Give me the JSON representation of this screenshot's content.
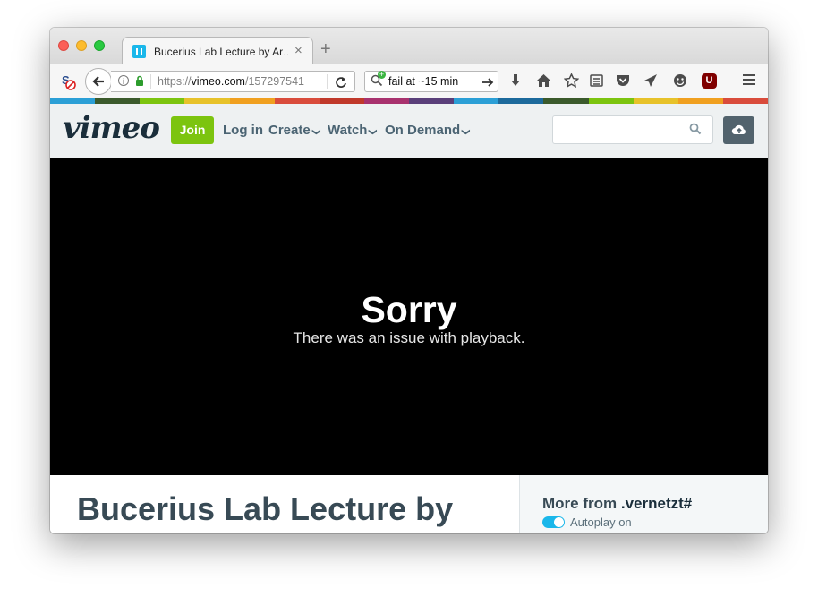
{
  "browser": {
    "tab": {
      "title": "Bucerius Lab Lecture by Ar…",
      "close": "×"
    },
    "new_tab": "+",
    "url": {
      "scheme": "https://",
      "host": "vimeo.com",
      "path": "/157297541"
    },
    "search_query": "fail at ~15 min",
    "extension_ublock": "U"
  },
  "colorbar": [
    "#2b9fd6",
    "#3b5a2c",
    "#7cc40f",
    "#e7c22a",
    "#f0a020",
    "#d94c3c",
    "#c0392b",
    "#a8326e",
    "#5a3f7a",
    "#2b9fd6",
    "#1d6a9c",
    "#3b5a2c",
    "#7cc40f",
    "#e7c22a",
    "#f0a020",
    "#d94c3c"
  ],
  "vimeo": {
    "logo": "vimeo",
    "join": "Join",
    "nav": {
      "login": "Log in",
      "create": "Create",
      "watch": "Watch",
      "on_demand": "On Demand"
    },
    "search_placeholder": ""
  },
  "player": {
    "error_title": "Sorry",
    "error_message": "There was an issue with playback."
  },
  "video": {
    "title": "Bucerius Lab Lecture by"
  },
  "sidebar": {
    "more_from_label": "More from",
    "channel": ".vernetzt#",
    "autoplay_label": "Autoplay on"
  }
}
